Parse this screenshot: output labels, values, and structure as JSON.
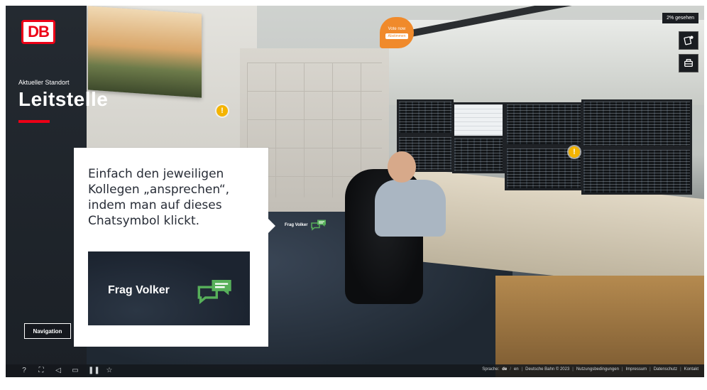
{
  "brand": {
    "logo_text": "DB",
    "logo_color": "#ec0016"
  },
  "location": {
    "label": "Aktueller Standort",
    "title": "Leitstelle"
  },
  "navigation_button": "Navigation",
  "progress": {
    "seen_label": "2% gesehen",
    "seen_percent": 2
  },
  "vote": {
    "title": "Vote now",
    "sub": "Abstimmen"
  },
  "hotspots": [
    {
      "glyph": "!"
    },
    {
      "glyph": "!"
    }
  ],
  "scene_chat": {
    "label": "Frag Volker",
    "icon": "chat-bubbles-icon"
  },
  "callout": {
    "lines": [
      "Einfach den jeweiligen",
      "Kollegen „ansprechen“,",
      "indem man auf dieses",
      "Chatsymbol klickt."
    ],
    "preview_label": "Frag Volker"
  },
  "colors": {
    "chat_green": "#57b05a",
    "hotspot": "#f4b400",
    "vote": "#f08a2b"
  },
  "footer": {
    "icons": [
      "help-icon",
      "fullscreen-icon",
      "sound-icon",
      "cardboard-icon",
      "pause-icon",
      "star-icon"
    ],
    "language_label": "Sprache:",
    "lang_active": "de",
    "lang_other": "en",
    "copyright": "Deutsche Bahn © 2023",
    "links": [
      "Nutzungsbedingungen",
      "Impressum",
      "Datenschutz",
      "Kontakt"
    ]
  }
}
